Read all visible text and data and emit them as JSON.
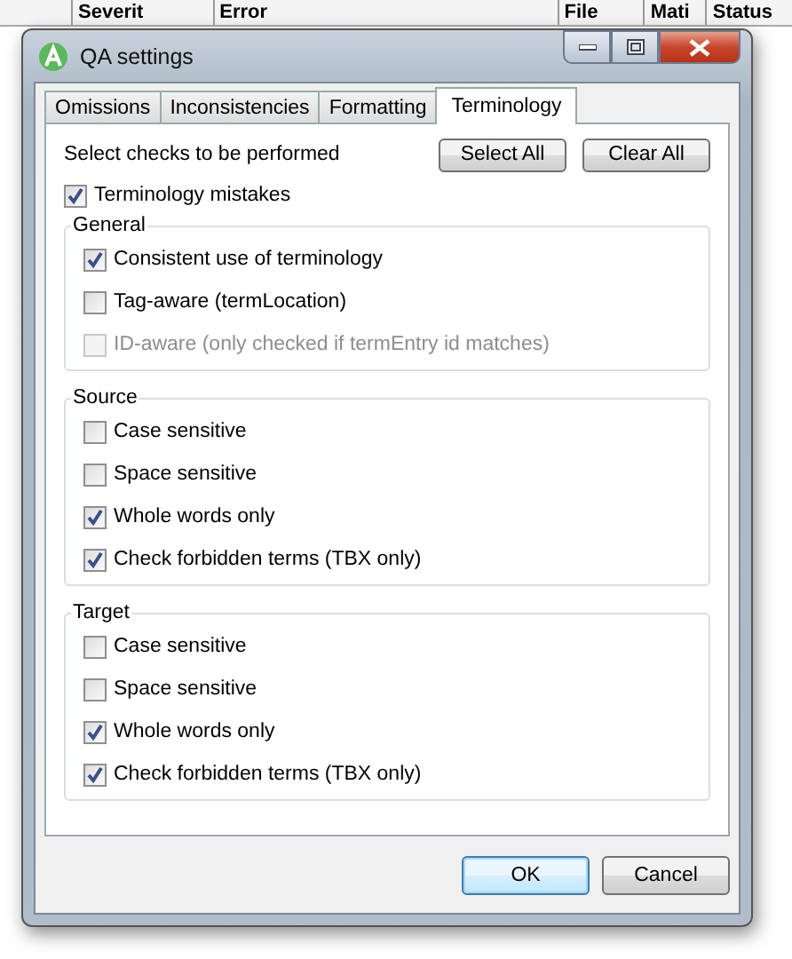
{
  "background_table": {
    "columns": [
      "Severit",
      "Error",
      "File",
      "Mati",
      "Status"
    ]
  },
  "window": {
    "title": "QA settings"
  },
  "tabs": [
    {
      "label": "Omissions",
      "selected": false
    },
    {
      "label": "Inconsistencies",
      "selected": false
    },
    {
      "label": "Formatting",
      "selected": false
    },
    {
      "label": "Terminology",
      "selected": true
    }
  ],
  "instruction": "Select checks to be performed",
  "top_buttons": [
    "Select All",
    "Clear All"
  ],
  "master": {
    "label": "Terminology mistakes",
    "checked": true
  },
  "groups": [
    {
      "title": "General",
      "items": [
        {
          "label": "Consistent use of terminology",
          "checked": true,
          "disabled": false
        },
        {
          "label": "Tag-aware (termLocation)",
          "checked": false,
          "disabled": false
        },
        {
          "label": "ID-aware (only checked if termEntry id matches)",
          "checked": false,
          "disabled": true
        }
      ]
    },
    {
      "title": "Source",
      "items": [
        {
          "label": "Case sensitive",
          "checked": false,
          "disabled": false
        },
        {
          "label": "Space sensitive",
          "checked": false,
          "disabled": false
        },
        {
          "label": "Whole words only",
          "checked": true,
          "disabled": false
        },
        {
          "label": "Check forbidden terms (TBX only)",
          "checked": true,
          "disabled": false
        }
      ]
    },
    {
      "title": "Target",
      "items": [
        {
          "label": "Case sensitive",
          "checked": false,
          "disabled": false
        },
        {
          "label": "Space sensitive",
          "checked": false,
          "disabled": false
        },
        {
          "label": "Whole words only",
          "checked": true,
          "disabled": false
        },
        {
          "label": "Check forbidden terms (TBX only)",
          "checked": true,
          "disabled": false
        }
      ]
    }
  ],
  "footer_buttons": [
    {
      "label": "OK",
      "default": true
    },
    {
      "label": "Cancel",
      "default": false
    }
  ]
}
